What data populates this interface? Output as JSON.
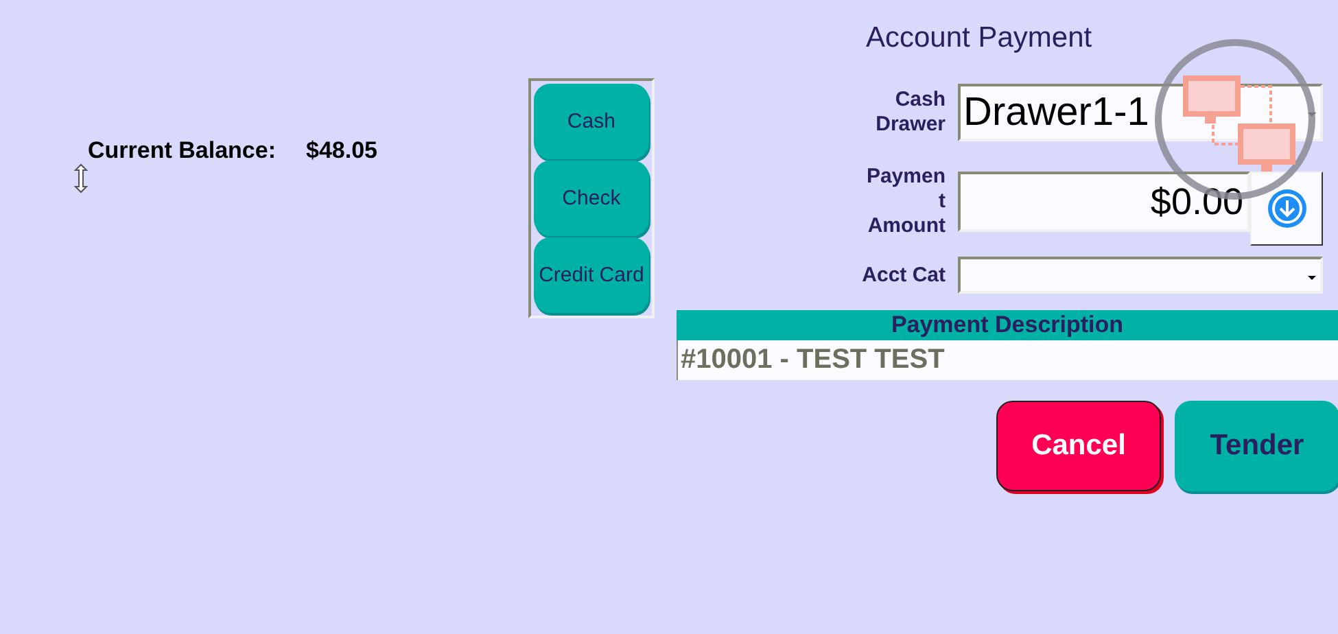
{
  "balance": {
    "label": "Current Balance:",
    "value": "$48.05"
  },
  "payment_methods": [
    "Cash",
    "Check",
    "Credit Card"
  ],
  "title": "Account Payment",
  "fields": [
    {
      "kind": "dropdown",
      "label": "Cash Drawer",
      "value": "Drawer1-1"
    },
    {
      "kind": "amount",
      "label": "Paymen t Amount",
      "value": "$0.00"
    },
    {
      "kind": "dropdown",
      "label": "Acct Cat"
    }
  ],
  "description": {
    "heading": "Payment Description",
    "value": "#10001 - TEST TEST"
  },
  "buttons": [
    {
      "kind": "cancel",
      "label": "Cancel"
    },
    {
      "kind": "tender",
      "label": "Tender"
    }
  ]
}
